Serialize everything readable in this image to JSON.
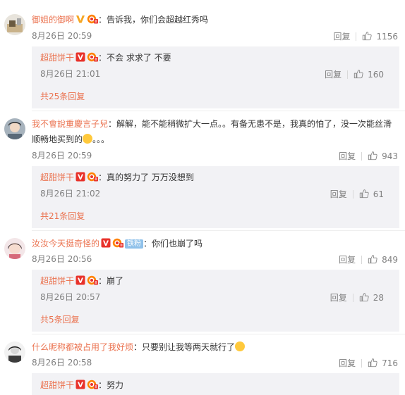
{
  "ui": {
    "reply_label": "回复",
    "separator": "："
  },
  "comments": [
    {
      "username": "御姐的御啊",
      "text": "告诉我，你们会超越红秀吗",
      "time": "8月26日 20:59",
      "likes": "1156",
      "reply": {
        "username": "超甜饼干",
        "text": "不会 求求了 不要",
        "time": "8月26日 21:01",
        "likes": "160",
        "more": "共25条回复"
      }
    },
    {
      "username": "我不會說重慶言子兒",
      "text": "解解，能不能稍微扩大一点。。有备无患不是，我真的怕了，没一次能丝滑",
      "text2": "顺畅地买到的",
      "text2_tail": "。。。",
      "time": "8月26日 20:59",
      "likes": "943",
      "reply": {
        "username": "超甜饼干",
        "text": "真的努力了 万万没想到",
        "time": "8月26日 21:02",
        "likes": "61",
        "more": "共21条回复"
      }
    },
    {
      "username": "汝汝今天挺奇怪的",
      "fan_badge": "铁粉",
      "text": "你们也崩了吗",
      "time": "8月26日 20:56",
      "likes": "849",
      "reply": {
        "username": "超甜饼干",
        "text": "崩了",
        "time": "8月26日 20:57",
        "likes": "28",
        "more": "共5条回复"
      }
    },
    {
      "username": "什么昵称都被占用了我好烦",
      "text": "只要别让我等两天就行了",
      "time": "8月26日 20:58",
      "likes": "716",
      "reply": {
        "username": "超甜饼干",
        "text": "努力"
      }
    }
  ]
}
